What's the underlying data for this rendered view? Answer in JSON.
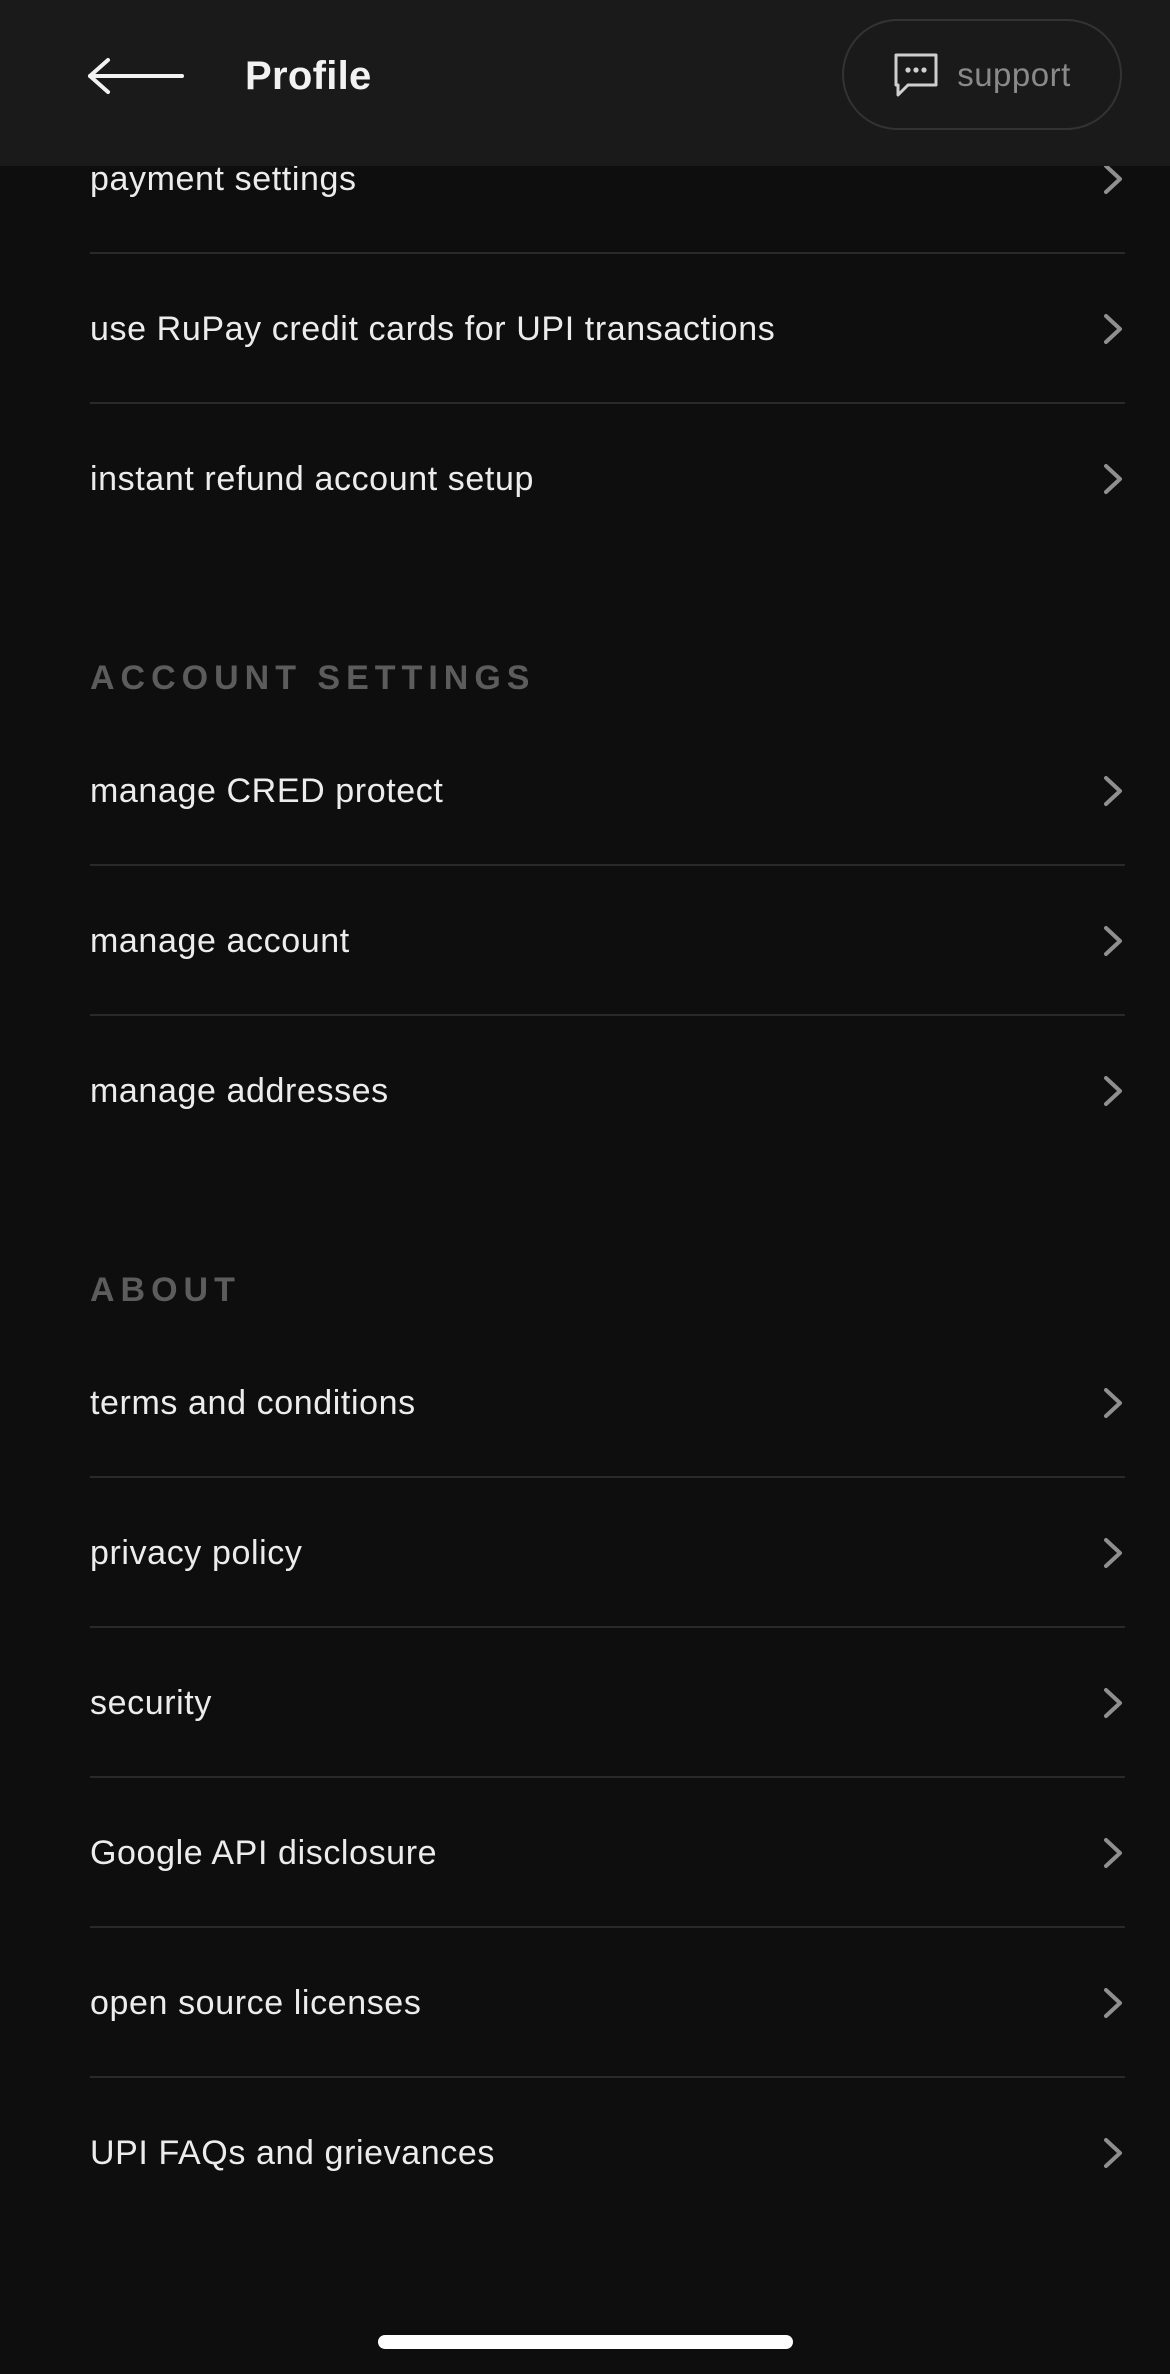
{
  "header": {
    "title": "Profile",
    "support_label": "support",
    "back_icon": "back-arrow-icon",
    "support_icon": "chat-bubble-icon",
    "background": "#1a1a1a"
  },
  "payments": {
    "items": [
      {
        "label": "payment settings"
      },
      {
        "label": "use RuPay credit cards for UPI transactions"
      },
      {
        "label": "instant refund account setup"
      }
    ]
  },
  "account_settings": {
    "title": "ACCOUNT SETTINGS",
    "items": [
      {
        "label": "manage CRED protect"
      },
      {
        "label": "manage account"
      },
      {
        "label": "manage addresses"
      }
    ]
  },
  "about": {
    "title": "ABOUT",
    "items": [
      {
        "label": "terms and conditions"
      },
      {
        "label": "privacy policy"
      },
      {
        "label": "security"
      },
      {
        "label": "Google API disclosure"
      },
      {
        "label": "open source licenses"
      },
      {
        "label": "UPI FAQs and grievances"
      }
    ]
  },
  "colors": {
    "background": "#0e0e0e",
    "text": "#ececec",
    "section_title": "#5c5c5c",
    "divider": "#2a2a2a",
    "chevron": "#8f8f8f"
  }
}
